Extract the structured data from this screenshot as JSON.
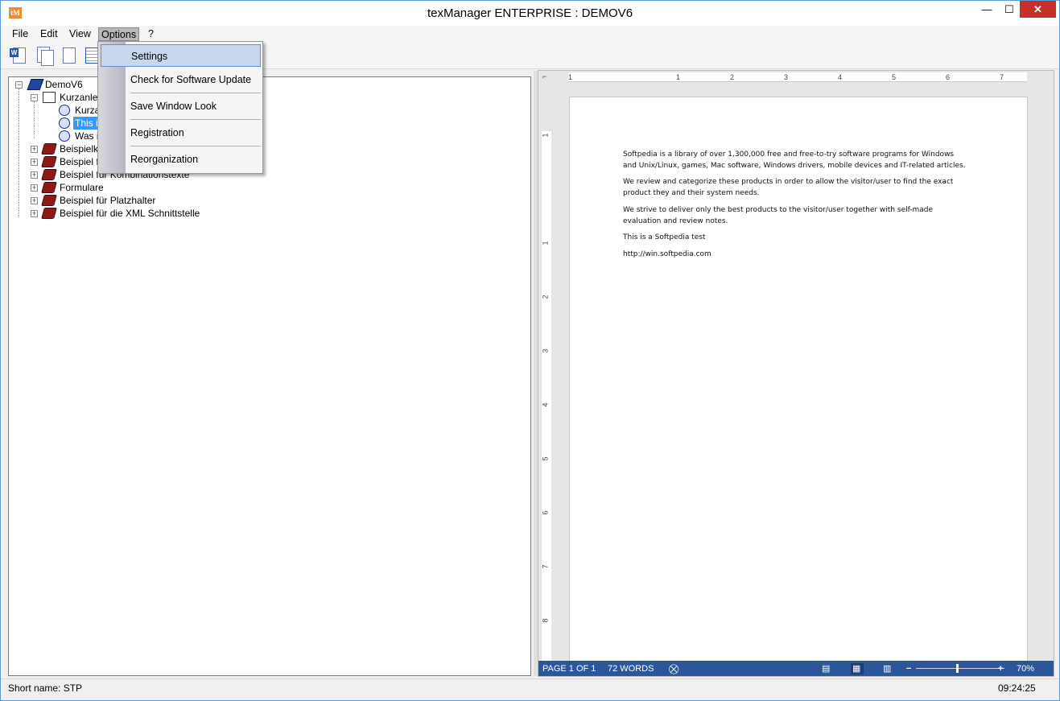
{
  "window": {
    "title": "texManager ENTERPRISE : DEMOV6",
    "icon_text": "tM",
    "minimize": "—",
    "maximize": "☐",
    "close": "✕"
  },
  "menu": {
    "items": [
      "File",
      "Edit",
      "View",
      "Options",
      "?"
    ],
    "active": "Options"
  },
  "options_menu": {
    "items": [
      "Settings",
      "Check for Software Update",
      "Save Window Look",
      "Registration",
      "Reorganization"
    ],
    "hovered": "Settings"
  },
  "tree": {
    "root": "DemoV6",
    "child_open": "Kurzanleit",
    "leaves": [
      "Kurza",
      "This is",
      "Was i"
    ],
    "selected": "This is",
    "folders": [
      "Beispielka",
      "Beispiel fü",
      "Beispiel für Kombinationstexte",
      "Formulare",
      "Beispiel für Platzhalter",
      "Beispiel für die XML Schnittstelle"
    ]
  },
  "ruler": {
    "h_ticks": [
      "1",
      "1",
      "2",
      "3",
      "4",
      "5",
      "6",
      "7"
    ],
    "v_ticks": [
      "1",
      "1",
      "2",
      "3",
      "4",
      "5",
      "6",
      "7",
      "8"
    ]
  },
  "document": {
    "paragraphs": [
      "Softpedia is a library of over 1,300,000 free and free-to-try software programs for Windows and Unix/Linux, games, Mac software, Windows drivers, mobile devices and IT-related articles.",
      "We review and categorize these products in order to allow the visitor/user to find the exact product they and their system needs.",
      "We strive to deliver only the best products to the visitor/user together with self-made evaluation and review notes.",
      "This is a Softpedia test",
      "http://win.softpedia.com"
    ]
  },
  "word_status": {
    "page": "PAGE 1 OF 1",
    "words": "72 WORDS",
    "zoom": "70%",
    "zoom_minus": "−",
    "zoom_plus": "+",
    "zoom_value": 0.45
  },
  "status": {
    "short_name": "Short name: STP",
    "time": "09:24:25"
  },
  "colors": {
    "word_status_bg": "#2b579a",
    "close_button": "#c7302a",
    "selection": "#3399ff"
  }
}
